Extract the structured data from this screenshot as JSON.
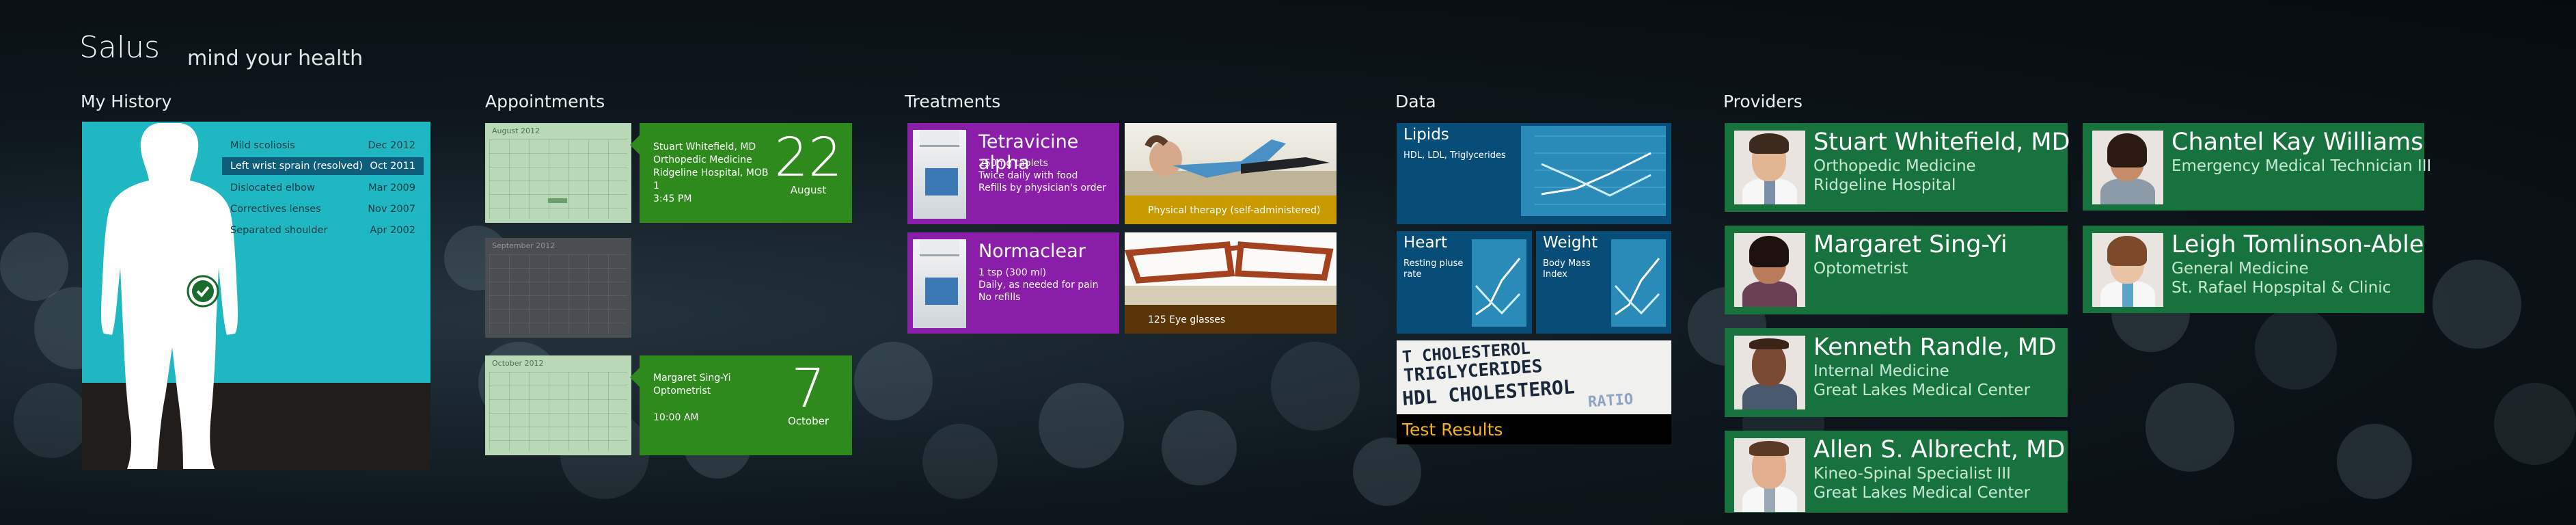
{
  "app": {
    "title": "Salus",
    "subtitle": "mind your health"
  },
  "sections": {
    "history": "My History",
    "appointments": "Appointments",
    "treatments": "Treatments",
    "data": "Data",
    "providers": "Providers"
  },
  "history": {
    "items": [
      {
        "label": "Mild scoliosis",
        "date": "Dec 2012"
      },
      {
        "label": "Left wrist sprain (resolved)",
        "date": "Oct 2011",
        "selected": true
      },
      {
        "label": "Dislocated elbow",
        "date": "Mar 2009"
      },
      {
        "label": "Correctives lenses",
        "date": "Nov 2007"
      },
      {
        "label": "Separated shoulder",
        "date": "Apr 2002"
      }
    ]
  },
  "appointments": {
    "calendars": [
      "August 2012",
      "September 2012",
      "October 2012"
    ],
    "items": [
      {
        "name": "Stuart Whitefield, MD",
        "dept": "Orthopedic Medicine",
        "location": "Ridgeline Hospital, MOB 1",
        "time": "3:45 PM",
        "day": "22",
        "month": "August"
      },
      {
        "name": "Margaret Sing-Yi",
        "dept": "Optometrist",
        "location": "",
        "time": "10:00 AM",
        "day": "7",
        "month": "October"
      }
    ]
  },
  "treatments": {
    "meds": [
      {
        "name": "Tetravicine alpha",
        "info1": "250mg tablets",
        "info2": "Twice daily with food",
        "info3": "Refills by physician's order"
      },
      {
        "name": "Normaclear",
        "info1": "1 tsp (300 ml)",
        "info2": "Daily, as needed for pain",
        "info3": "No refills"
      }
    ],
    "therapy": {
      "caption": "Physical therapy (self-administered)"
    },
    "glasses": {
      "caption": "125 Eye glasses"
    }
  },
  "data": {
    "lipids": {
      "title": "Lipids",
      "sub": "HDL, LDL, Triglycerides"
    },
    "heart": {
      "title": "Heart",
      "sub1": "Resting pluse",
      "sub2": "rate"
    },
    "weight": {
      "title": "Weight",
      "sub1": "Body Mass",
      "sub2": "Index"
    },
    "test_results": {
      "caption": "Test Results",
      "lines": [
        "T CHOLESTEROL",
        "TRIGLYCERIDES",
        "HDL CHOLESTEROL",
        "RATIO"
      ]
    }
  },
  "providers": [
    {
      "name": "Stuart Whitefield, MD",
      "line1": "Orthopedic Medicine",
      "line2": "Ridgeline Hospital"
    },
    {
      "name": "Chantel Kay Williams",
      "line1": "Emergency Medical Technician III",
      "line2": ""
    },
    {
      "name": "Margaret Sing-Yi",
      "line1": "Optometrist",
      "line2": ""
    },
    {
      "name": "Leigh Tomlinson-Able",
      "line1": "General Medicine",
      "line2": "St. Rafael Hopspital & Clinic"
    },
    {
      "name": "Kenneth Randle, MD",
      "line1": "Internal Medicine",
      "line2": "Great Lakes Medical Center"
    },
    {
      "name": "Allen S. Albrecht, MD",
      "line1": "Kineo-Spinal Specialist III",
      "line2": "Great Lakes Medical Center"
    }
  ],
  "colors": {
    "history": "#1fb7c1",
    "appointment": "#2e8a1c",
    "treatment": "#8b1ea8",
    "data": "#084c78",
    "provider": "#17723e",
    "test_caption": "#f4b21a"
  }
}
